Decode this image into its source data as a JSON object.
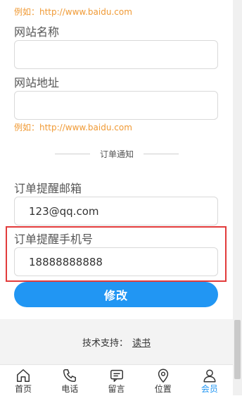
{
  "form": {
    "hint_top": "例如：http://www.baidu.com",
    "site_name_label": "网站名称",
    "site_name_value": "",
    "site_url_label": "网站地址",
    "site_url_value": "",
    "hint_url": "例如：http://www.baidu.com",
    "section_title": "订单通知",
    "order_email_label": "订单提醒邮箱",
    "order_email_value": "123@qq.com",
    "order_phone_label": "订单提醒手机号",
    "order_phone_value": "18888888888",
    "submit_label": "修改"
  },
  "footer": {
    "support_label": "技术支持：",
    "support_link": "读书"
  },
  "tabbar": {
    "items": [
      {
        "label": "首页",
        "icon": "home-icon"
      },
      {
        "label": "电话",
        "icon": "phone-icon"
      },
      {
        "label": "留言",
        "icon": "message-icon"
      },
      {
        "label": "位置",
        "icon": "location-icon"
      },
      {
        "label": "会员",
        "icon": "user-icon",
        "active": true
      }
    ]
  },
  "colors": {
    "accent": "#2196f3",
    "hint": "#f09a35",
    "highlight": "#e23b3b"
  }
}
